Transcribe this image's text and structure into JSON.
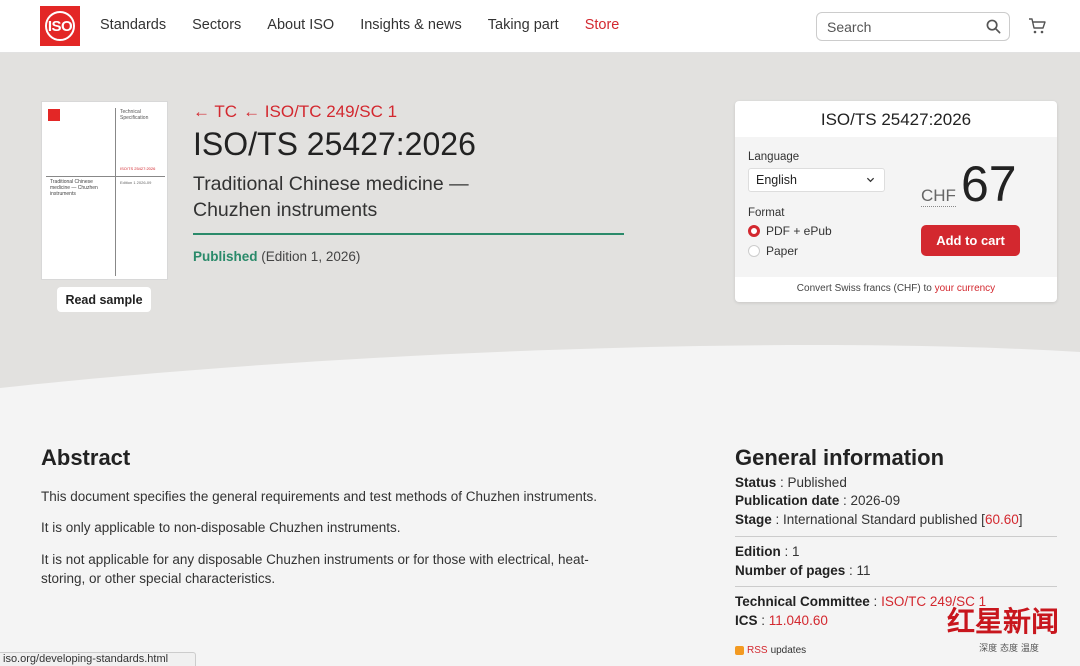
{
  "header": {
    "logo_text": "ISO",
    "nav": [
      {
        "label": "Standards"
      },
      {
        "label": "Sectors"
      },
      {
        "label": "About ISO"
      },
      {
        "label": "Insights & news"
      },
      {
        "label": "Taking part"
      },
      {
        "label": "Store"
      }
    ],
    "search_placeholder": "Search"
  },
  "cover": {
    "heading": "Technical Specification",
    "code": "ISO/TS 25427:2026",
    "title": "Traditional Chinese medicine — Chuzhen instruments",
    "edition": "Edition 1 2026-09"
  },
  "read_sample": "Read sample",
  "breadcrumb": {
    "tc": "← TC",
    "sc": "← ISO/TC 249/SC 1"
  },
  "title": "ISO/TS 25427:2026",
  "subtitle": "Traditional Chinese medicine — Chuzhen instruments",
  "status": {
    "published": "Published",
    "edition": "(Edition 1, 2026)"
  },
  "price_card": {
    "title": "ISO/TS 25427:2026",
    "language_label": "Language",
    "language_value": "English",
    "format_label": "Format",
    "formats": [
      {
        "label": "PDF + ePub",
        "selected": true
      },
      {
        "label": "Paper",
        "selected": false
      }
    ],
    "currency": "CHF",
    "price": "67",
    "add_to_cart": "Add to cart",
    "convert_text": "Convert Swiss francs (CHF) to",
    "convert_link": "your currency"
  },
  "abstract": {
    "heading": "Abstract",
    "paragraphs": [
      "This document specifies the general requirements and test methods of Chuzhen instruments.",
      "It is only applicable to non-disposable Chuzhen instruments.",
      "It is not applicable for any disposable Chuzhen instruments or for those with electrical, heat-storing, or other special characteristics."
    ]
  },
  "general_info": {
    "heading": "General information",
    "status_label": "Status",
    "status_value": "Published",
    "pubdate_label": "Publication date",
    "pubdate_value": "2026-09",
    "stage_label": "Stage",
    "stage_value": "International Standard published [",
    "stage_code": "60.60",
    "stage_close": "]",
    "edition_label": "Edition",
    "edition_value": "1",
    "pages_label": "Number of pages",
    "pages_value": "11",
    "tc_label": "Technical Committee",
    "tc_value": "ISO/TC 249/SC 1",
    "ics_label": "ICS",
    "ics_value": "11.040.60",
    "rss_link": "RSS",
    "rss_text": "updates"
  },
  "status_url": "iso.org/developing-standards.html",
  "watermark": {
    "big": "红星新闻",
    "small": "深度 态度 温度"
  },
  "colors": {
    "accent": "#d3282f",
    "published": "#2a8a6a"
  }
}
